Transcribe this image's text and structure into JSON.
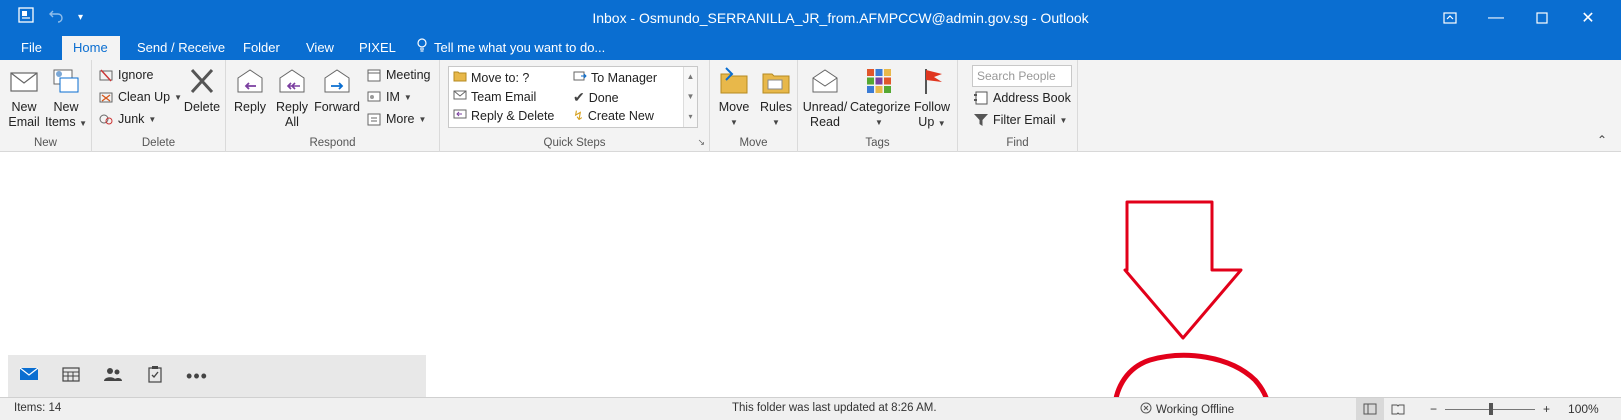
{
  "titlebar": {
    "title": "Inbox - Osmundo_SERRANILLA_JR_from.AFMPCCW@admin.gov.sg - Outlook"
  },
  "tabs": {
    "file": "File",
    "home": "Home",
    "send_receive": "Send / Receive",
    "folder": "Folder",
    "view": "View",
    "pixel": "PIXEL",
    "tell_me": "Tell me what you want to do..."
  },
  "ribbon": {
    "new": {
      "label": "New",
      "new_email_1": "New",
      "new_email_2": "Email",
      "new_items_1": "New",
      "new_items_2": "Items"
    },
    "delete": {
      "label": "Delete",
      "ignore": "Ignore",
      "clean_up": "Clean Up",
      "junk": "Junk",
      "delete": "Delete"
    },
    "respond": {
      "label": "Respond",
      "reply": "Reply",
      "reply_all_1": "Reply",
      "reply_all_2": "All",
      "forward": "Forward",
      "meeting": "Meeting",
      "im": "IM",
      "more": "More"
    },
    "quick_steps": {
      "label": "Quick Steps",
      "items": [
        "Move to: ?",
        "To Manager",
        "Team Email",
        "Done",
        "Reply & Delete",
        "Create New"
      ]
    },
    "move": {
      "label": "Move",
      "move": "Move",
      "rules": "Rules"
    },
    "tags": {
      "label": "Tags",
      "unread_1": "Unread/",
      "unread_2": "Read",
      "categorize": "Categorize",
      "follow_1": "Follow",
      "follow_2": "Up"
    },
    "find": {
      "label": "Find",
      "search_placeholder": "Search People",
      "address_book": "Address Book",
      "filter_email": "Filter Email"
    }
  },
  "statusbar": {
    "items": "Items: 14",
    "updated": "This folder was last updated at 8:26 AM.",
    "offline": "Working Offline",
    "zoom": "100%"
  },
  "colors": {
    "brand": "#0a6ed1",
    "annotation": "#e2001a"
  }
}
